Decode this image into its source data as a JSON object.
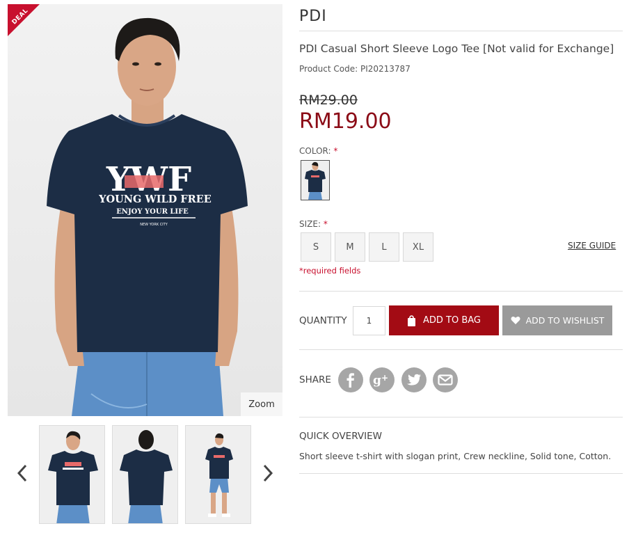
{
  "badge": {
    "deal": "DEAL"
  },
  "gallery": {
    "zoom_label": "Zoom",
    "main_print": {
      "line1": "YWF",
      "line2": "YOUNG WILD FREE",
      "line3": "ENJOY YOUR LIFE",
      "line4": "NEW YORK CITY"
    }
  },
  "product": {
    "brand": "PDI",
    "title": "PDI Casual Short Sleeve Logo Tee [Not valid for Exchange]",
    "code_label": "Product Code:",
    "code": "PI20213787",
    "old_price": "RM29.00",
    "price": "RM19.00"
  },
  "color": {
    "label": "COLOR:",
    "required_mark": "*",
    "selected": "navy"
  },
  "size": {
    "label": "SIZE:",
    "required_mark": "*",
    "options": [
      "S",
      "M",
      "L",
      "XL"
    ],
    "guide_label": "SIZE GUIDE",
    "required_note": "*required fields"
  },
  "purchase": {
    "quantity_label": "QUANTITY",
    "quantity_value": "1",
    "add_to_bag": "ADD TO BAG",
    "add_to_wishlist": "ADD TO WISHLIST"
  },
  "share": {
    "label": "SHARE",
    "networks": [
      "facebook-icon",
      "google-plus-icon",
      "twitter-icon",
      "email-icon"
    ]
  },
  "overview": {
    "title": "QUICK OVERVIEW",
    "text": "Short sleeve t-shirt with slogan print, Crew neckline, Solid tone, Cotton."
  },
  "colors": {
    "accent": "#a30b14",
    "price": "#8b0b16",
    "required": "#c8102e",
    "wishlist": "#9a9a9a",
    "shirt": "#1c2d45",
    "jeans": "#5c8fc7"
  }
}
